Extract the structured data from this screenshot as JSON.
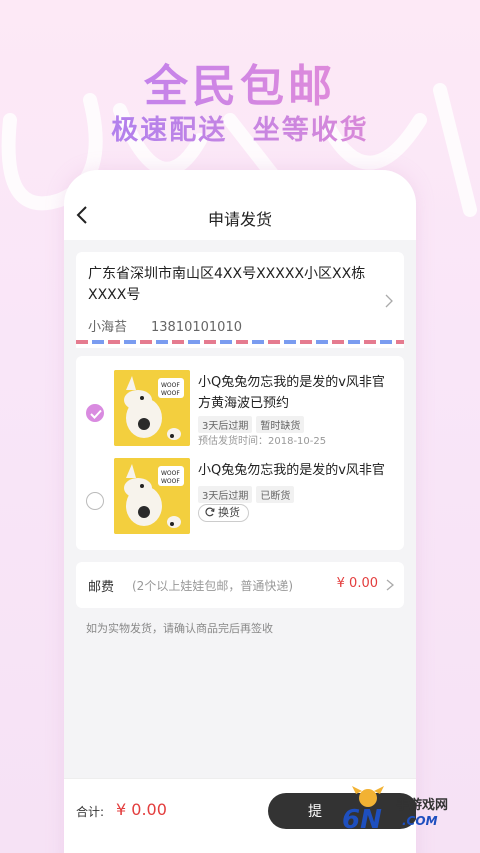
{
  "promo": {
    "title": "全民包邮",
    "subtitle": "极速配送  坐等收货"
  },
  "nav": {
    "title": "申请发货",
    "back_icon": "chevron-left-icon"
  },
  "address": {
    "line": "广东省深圳市南山区4XX号XXXXX小区XX栋XXXX号",
    "name": "小海苔",
    "phone": "13810101010"
  },
  "items": [
    {
      "name": "小Q兔兔勿忘我的是发的v风非官方黄海波已预约",
      "selected": true,
      "tags": [
        "3天后过期",
        "暂时缺货"
      ],
      "estimate": "预估发货时间：2018-10-25"
    },
    {
      "name": "小Q兔兔勿忘我的是发的v风非官",
      "selected": false,
      "tags": [
        "3天后过期",
        "已断货"
      ],
      "swap_label": "换货"
    }
  ],
  "shipping": {
    "label": "邮费",
    "note": "(2个以上娃娃包邮，普通快递)",
    "price": "¥ 0.00"
  },
  "hint": "如为实物发货，请确认商品完后再签收",
  "footer": {
    "total_label": "合计:",
    "total_value": "¥ 0.00",
    "submit_label": "提"
  },
  "watermark": {
    "text": "手游戏网",
    "com": ".COM",
    "logo": "6NIU"
  },
  "colors": {
    "accent": "#d98be0",
    "price": "#e33d3d",
    "button": "#333333",
    "airmail_red": "#e57b8f",
    "airmail_blue": "#7a9cf0"
  }
}
